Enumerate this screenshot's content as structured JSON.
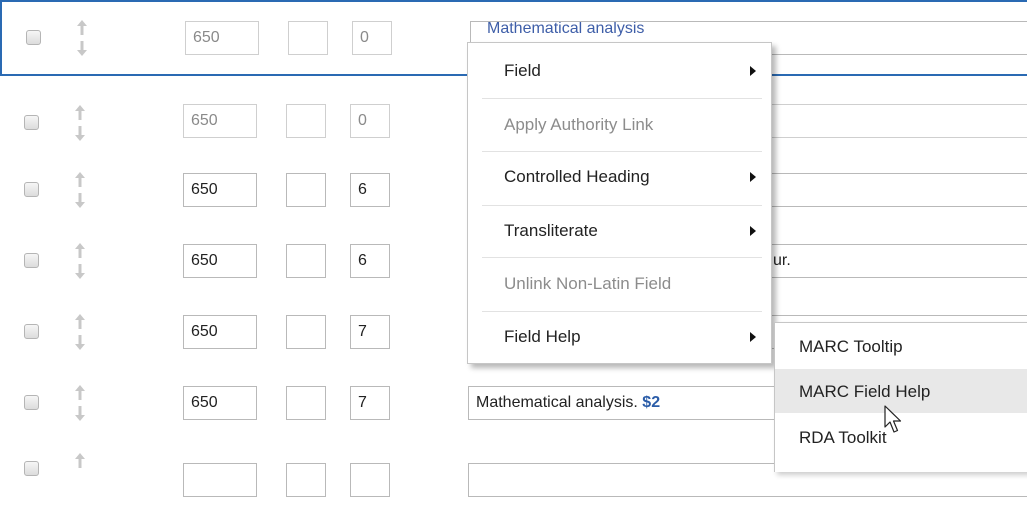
{
  "rows": [
    {
      "tag": "650",
      "ind1": "",
      "ind2": "0",
      "content": "Mathematical analysis",
      "selected": true,
      "dim": false
    },
    {
      "tag": "650",
      "ind1": "",
      "ind2": "0",
      "content": "",
      "selected": false,
      "dim": true
    },
    {
      "tag": "650",
      "ind1": "",
      "ind2": "6",
      "content": "",
      "selected": false,
      "dim": false
    },
    {
      "tag": "650",
      "ind1": "",
      "ind2": "6",
      "content": "ur.",
      "selected": false,
      "dim": false
    },
    {
      "tag": "650",
      "ind1": "",
      "ind2": "7",
      "content": "",
      "selected": false,
      "dim": false
    },
    {
      "tag": "650",
      "ind1": "",
      "ind2": "7",
      "content": "Mathematical analysis.",
      "subfield": "$2",
      "selected": false,
      "dim": false
    }
  ],
  "context_menu": {
    "items": [
      {
        "label": "Field",
        "has_submenu": true,
        "disabled": false
      },
      {
        "label": "Apply Authority Link",
        "has_submenu": false,
        "disabled": true
      },
      {
        "label": "Controlled Heading",
        "has_submenu": true,
        "disabled": false
      },
      {
        "label": "Transliterate",
        "has_submenu": true,
        "disabled": false
      },
      {
        "label": "Unlink Non-Latin Field",
        "has_submenu": false,
        "disabled": true
      },
      {
        "label": "Field Help",
        "has_submenu": true,
        "disabled": false
      }
    ]
  },
  "submenu": {
    "items": [
      {
        "label": "MARC Tooltip",
        "hover": false
      },
      {
        "label": "MARC Field Help",
        "hover": true
      },
      {
        "label": "RDA Toolkit",
        "hover": false
      }
    ]
  },
  "colors": {
    "selection_border": "#2a6ab3",
    "subfield_code": "#2a5ca8",
    "hover_bg": "#e8e8e8"
  },
  "icons": {
    "move": "up-down-arrows-icon",
    "cursor": "mouse-pointer-icon"
  }
}
